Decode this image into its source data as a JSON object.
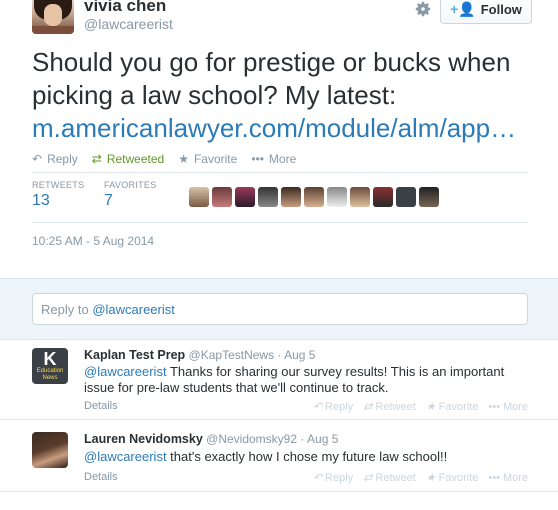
{
  "tweet": {
    "fullname": "vivia chen",
    "username": "@lawcareerist",
    "follow_label": "Follow",
    "text": "Should you go for prestige or bucks when picking a law school? My latest: ",
    "link": "m.americanlawyer.com/module/alm/app…",
    "actions": {
      "reply": "Reply",
      "retweeted": "Retweeted",
      "favorite": "Favorite",
      "more": "More"
    },
    "stats": {
      "retweets_label": "RETWEETS",
      "retweets_value": "13",
      "favorites_label": "FAVORITES",
      "favorites_value": "7"
    },
    "timestamp": "10:25 AM - 5 Aug 2014"
  },
  "reply_box": {
    "prefix": "Reply to ",
    "mention": "@lawcareerist"
  },
  "replies": [
    {
      "name": "Kaplan Test Prep",
      "handle": "@KapTestNews",
      "date": "· Aug 5",
      "mention": "@lawcareerist",
      "text": " Thanks for sharing our survey results! This is an important issue for pre-law students that we'll continue to track.",
      "details": "Details",
      "avatar_letter": "K",
      "avatar_sub": "Education News"
    },
    {
      "name": "Lauren Nevidomsky",
      "handle": "@Nevidomsky92",
      "date": "· Aug 5",
      "mention": "@lawcareerist",
      "text": " that's exactly how I chose my future law school!!",
      "details": "Details"
    }
  ],
  "reply_actions": {
    "reply": "Reply",
    "retweet": "Retweet",
    "favorite": "Favorite",
    "more": "More"
  },
  "colors": {
    "link": "#2b7bb9",
    "retweeted": "#609928",
    "muted": "#8899a6"
  }
}
